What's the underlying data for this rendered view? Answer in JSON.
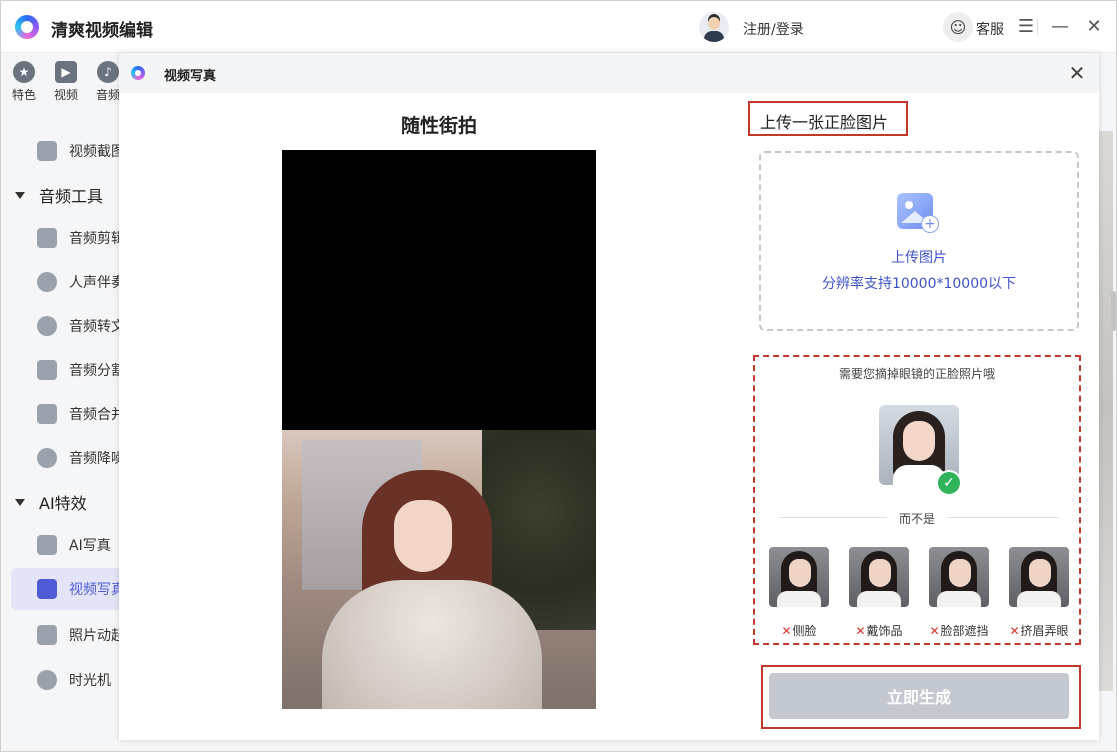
{
  "app": {
    "title": "清爽视频编辑",
    "login": "注册/登录",
    "service": "客服"
  },
  "topnav": {
    "items": [
      {
        "label": "特色",
        "icon": "star-icon"
      },
      {
        "label": "视频",
        "icon": "film-icon"
      },
      {
        "label": "音频",
        "icon": "music-icon"
      }
    ]
  },
  "sidebar": {
    "items": [
      {
        "label": "视频截图",
        "type": "item"
      },
      {
        "label": "音频工具",
        "type": "section"
      },
      {
        "label": "音频剪辑",
        "type": "item"
      },
      {
        "label": "人声伴奏",
        "type": "item"
      },
      {
        "label": "音频转文",
        "type": "item"
      },
      {
        "label": "音频分割",
        "type": "item"
      },
      {
        "label": "音频合并",
        "type": "item"
      },
      {
        "label": "音频降噪",
        "type": "item"
      },
      {
        "label": "AI特效",
        "type": "section"
      },
      {
        "label": "AI写真",
        "type": "item"
      },
      {
        "label": "视频写真",
        "type": "item",
        "active": true
      },
      {
        "label": "照片动起",
        "type": "item"
      },
      {
        "label": "时光机",
        "type": "item"
      }
    ]
  },
  "dialog": {
    "title": "视频写真",
    "style_title": "随性街拍",
    "upload_heading": "上传一张正脸图片",
    "upload_label": "上传图片",
    "upload_sub": "分辨率支持10000*10000以下",
    "guide_note": "需要您摘掉眼镜的正脸照片哦",
    "divider": "而不是",
    "bad_examples": [
      "侧脸",
      "戴饰品",
      "脸部遮挡",
      "挤眉弄眼"
    ],
    "bad_mark": "✕",
    "generate": "立即生成"
  },
  "colors": {
    "accent": "#4f5bd5",
    "highlight_border": "#c0392b",
    "button_disabled": "#c3c8d1",
    "ok_green": "#30b35a"
  }
}
